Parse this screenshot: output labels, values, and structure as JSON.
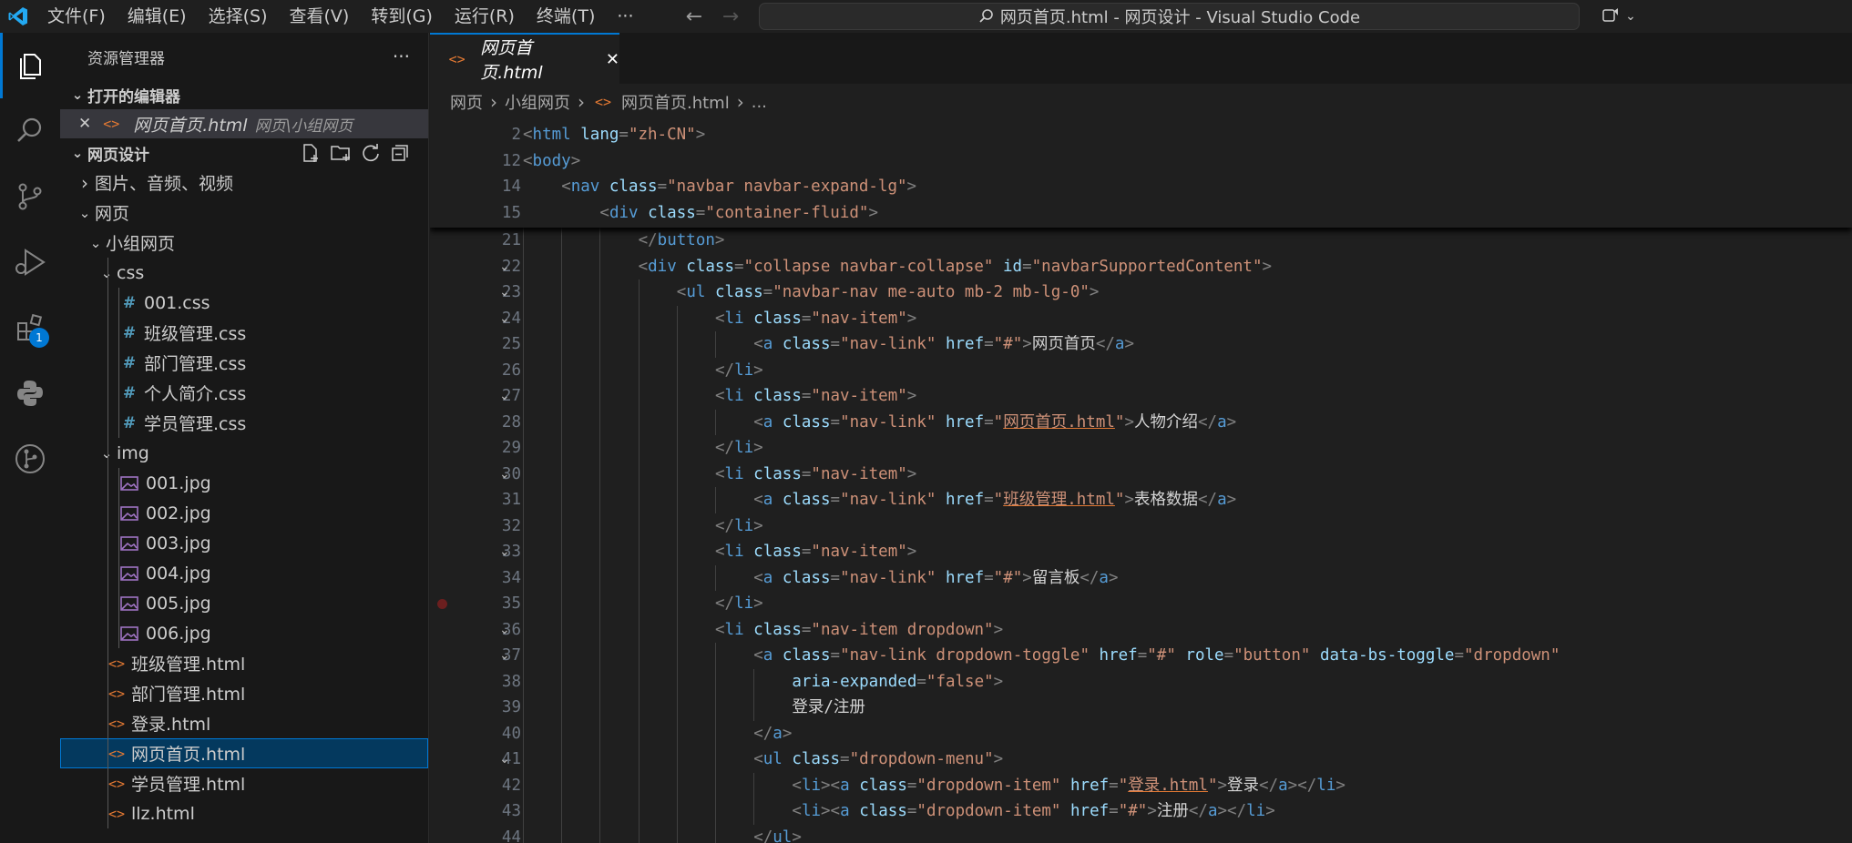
{
  "titlebar": {
    "menus": [
      "文件(F)",
      "编辑(E)",
      "选择(S)",
      "查看(V)",
      "转到(G)",
      "运行(R)",
      "终端(T)",
      "···"
    ],
    "command_center": "网页首页.html - 网页设计 - Visual Studio Code",
    "back_arrow": "←",
    "forward_arrow": "→"
  },
  "activitybar": {
    "extensions_badge": "1"
  },
  "sidebar": {
    "title": "资源管理器",
    "more": "···",
    "open_editors_header": "打开的编辑器",
    "open_editor": {
      "name": "网页首页.html",
      "path": "网页\\小组网页"
    },
    "workspace_header": "网页设计",
    "tree": [
      {
        "label": "图片、音频、视频",
        "kind": "folder",
        "depth": 0,
        "open": false
      },
      {
        "label": "网页",
        "kind": "folder",
        "depth": 0,
        "open": true
      },
      {
        "label": "小组网页",
        "kind": "folder",
        "depth": 1,
        "open": true
      },
      {
        "label": "css",
        "kind": "folder",
        "depth": 2,
        "open": true
      },
      {
        "label": "001.css",
        "kind": "css",
        "depth": 3
      },
      {
        "label": "班级管理.css",
        "kind": "css",
        "depth": 3
      },
      {
        "label": "部门管理.css",
        "kind": "css",
        "depth": 3
      },
      {
        "label": "个人简介.css",
        "kind": "css",
        "depth": 3
      },
      {
        "label": "学员管理.css",
        "kind": "css",
        "depth": 3
      },
      {
        "label": "img",
        "kind": "folder",
        "depth": 2,
        "open": true
      },
      {
        "label": "001.jpg",
        "kind": "img",
        "depth": 3
      },
      {
        "label": "002.jpg",
        "kind": "img",
        "depth": 3
      },
      {
        "label": "003.jpg",
        "kind": "img",
        "depth": 3
      },
      {
        "label": "004.jpg",
        "kind": "img",
        "depth": 3
      },
      {
        "label": "005.jpg",
        "kind": "img",
        "depth": 3
      },
      {
        "label": "006.jpg",
        "kind": "img",
        "depth": 3
      },
      {
        "label": "班级管理.html",
        "kind": "html",
        "depth": 2
      },
      {
        "label": "部门管理.html",
        "kind": "html",
        "depth": 2
      },
      {
        "label": "登录.html",
        "kind": "html",
        "depth": 2
      },
      {
        "label": "网页首页.html",
        "kind": "html",
        "depth": 2,
        "selected": true
      },
      {
        "label": "学员管理.html",
        "kind": "html",
        "depth": 2
      },
      {
        "label": "llz.html",
        "kind": "html",
        "depth": 2
      }
    ]
  },
  "editor": {
    "tab_label": "网页首页.html",
    "breadcrumb": [
      "网页",
      "小组网页",
      "网页首页.html",
      "..."
    ],
    "sticky_lines": [
      {
        "n": "2",
        "indent": 0,
        "tokens": [
          [
            "pn",
            "<"
          ],
          [
            "tg",
            "html"
          ],
          [
            "tx",
            " "
          ],
          [
            "at",
            "lang"
          ],
          [
            "pn",
            "="
          ],
          [
            "st",
            "\"zh-CN\""
          ],
          [
            "pn",
            ">"
          ]
        ]
      },
      {
        "n": "12",
        "indent": 0,
        "tokens": [
          [
            "pn",
            "<"
          ],
          [
            "tg",
            "body"
          ],
          [
            "pn",
            ">"
          ]
        ]
      },
      {
        "n": "14",
        "indent": 1,
        "tokens": [
          [
            "pn",
            "<"
          ],
          [
            "tg",
            "nav"
          ],
          [
            "tx",
            " "
          ],
          [
            "at",
            "class"
          ],
          [
            "pn",
            "="
          ],
          [
            "st",
            "\"navbar navbar-expand-lg\""
          ],
          [
            "pn",
            ">"
          ]
        ]
      },
      {
        "n": "15",
        "indent": 2,
        "tokens": [
          [
            "pn",
            "<"
          ],
          [
            "tg",
            "div"
          ],
          [
            "tx",
            " "
          ],
          [
            "at",
            "class"
          ],
          [
            "pn",
            "="
          ],
          [
            "st",
            "\"container-fluid\""
          ],
          [
            "pn",
            ">"
          ]
        ]
      }
    ],
    "lines": [
      {
        "n": "21",
        "indent": 3,
        "tokens": [
          [
            "pn",
            "</"
          ],
          [
            "tg",
            "button"
          ],
          [
            "pn",
            ">"
          ]
        ]
      },
      {
        "n": "22",
        "indent": 3,
        "fold": true,
        "tokens": [
          [
            "pn",
            "<"
          ],
          [
            "tg",
            "div"
          ],
          [
            "tx",
            " "
          ],
          [
            "at",
            "class"
          ],
          [
            "pn",
            "="
          ],
          [
            "st",
            "\"collapse navbar-collapse\""
          ],
          [
            "tx",
            " "
          ],
          [
            "at",
            "id"
          ],
          [
            "pn",
            "="
          ],
          [
            "st",
            "\"navbarSupportedContent\""
          ],
          [
            "pn",
            ">"
          ]
        ]
      },
      {
        "n": "23",
        "indent": 4,
        "fold": true,
        "tokens": [
          [
            "pn",
            "<"
          ],
          [
            "tg",
            "ul"
          ],
          [
            "tx",
            " "
          ],
          [
            "at",
            "class"
          ],
          [
            "pn",
            "="
          ],
          [
            "st",
            "\"navbar-nav me-auto mb-2 mb-lg-0\""
          ],
          [
            "pn",
            ">"
          ]
        ]
      },
      {
        "n": "24",
        "indent": 5,
        "fold": true,
        "tokens": [
          [
            "pn",
            "<"
          ],
          [
            "tg",
            "li"
          ],
          [
            "tx",
            " "
          ],
          [
            "at",
            "class"
          ],
          [
            "pn",
            "="
          ],
          [
            "st",
            "\"nav-item\""
          ],
          [
            "pn",
            ">"
          ]
        ]
      },
      {
        "n": "25",
        "indent": 6,
        "tokens": [
          [
            "pn",
            "<"
          ],
          [
            "tg",
            "a"
          ],
          [
            "tx",
            " "
          ],
          [
            "at",
            "class"
          ],
          [
            "pn",
            "="
          ],
          [
            "st",
            "\"nav-link\""
          ],
          [
            "tx",
            " "
          ],
          [
            "at",
            "href"
          ],
          [
            "pn",
            "="
          ],
          [
            "st",
            "\"#\""
          ],
          [
            "pn",
            ">"
          ],
          [
            "tx",
            "网页首页"
          ],
          [
            "pn",
            "</"
          ],
          [
            "tg",
            "a"
          ],
          [
            "pn",
            ">"
          ]
        ]
      },
      {
        "n": "26",
        "indent": 5,
        "tokens": [
          [
            "pn",
            "</"
          ],
          [
            "tg",
            "li"
          ],
          [
            "pn",
            ">"
          ]
        ]
      },
      {
        "n": "27",
        "indent": 5,
        "fold": true,
        "tokens": [
          [
            "pn",
            "<"
          ],
          [
            "tg",
            "li"
          ],
          [
            "tx",
            " "
          ],
          [
            "at",
            "class"
          ],
          [
            "pn",
            "="
          ],
          [
            "st",
            "\"nav-item\""
          ],
          [
            "pn",
            ">"
          ]
        ]
      },
      {
        "n": "28",
        "indent": 6,
        "tokens": [
          [
            "pn",
            "<"
          ],
          [
            "tg",
            "a"
          ],
          [
            "tx",
            " "
          ],
          [
            "at",
            "class"
          ],
          [
            "pn",
            "="
          ],
          [
            "st",
            "\"nav-link\""
          ],
          [
            "tx",
            " "
          ],
          [
            "at",
            "href"
          ],
          [
            "pn",
            "="
          ],
          [
            "st",
            "\""
          ],
          [
            "stu",
            "网页首页.html"
          ],
          [
            "st",
            "\""
          ],
          [
            "pn",
            ">"
          ],
          [
            "tx",
            "人物介绍"
          ],
          [
            "pn",
            "</"
          ],
          [
            "tg",
            "a"
          ],
          [
            "pn",
            ">"
          ]
        ]
      },
      {
        "n": "29",
        "indent": 5,
        "tokens": [
          [
            "pn",
            "</"
          ],
          [
            "tg",
            "li"
          ],
          [
            "pn",
            ">"
          ]
        ]
      },
      {
        "n": "30",
        "indent": 5,
        "fold": true,
        "tokens": [
          [
            "pn",
            "<"
          ],
          [
            "tg",
            "li"
          ],
          [
            "tx",
            " "
          ],
          [
            "at",
            "class"
          ],
          [
            "pn",
            "="
          ],
          [
            "st",
            "\"nav-item\""
          ],
          [
            "pn",
            ">"
          ]
        ]
      },
      {
        "n": "31",
        "indent": 6,
        "tokens": [
          [
            "pn",
            "<"
          ],
          [
            "tg",
            "a"
          ],
          [
            "tx",
            " "
          ],
          [
            "at",
            "class"
          ],
          [
            "pn",
            "="
          ],
          [
            "st",
            "\"nav-link\""
          ],
          [
            "tx",
            " "
          ],
          [
            "at",
            "href"
          ],
          [
            "pn",
            "="
          ],
          [
            "st",
            "\""
          ],
          [
            "stu",
            "班级管理.html"
          ],
          [
            "st",
            "\""
          ],
          [
            "pn",
            ">"
          ],
          [
            "tx",
            "表格数据"
          ],
          [
            "pn",
            "</"
          ],
          [
            "tg",
            "a"
          ],
          [
            "pn",
            ">"
          ]
        ]
      },
      {
        "n": "32",
        "indent": 5,
        "tokens": [
          [
            "pn",
            "</"
          ],
          [
            "tg",
            "li"
          ],
          [
            "pn",
            ">"
          ]
        ]
      },
      {
        "n": "33",
        "indent": 5,
        "fold": true,
        "tokens": [
          [
            "pn",
            "<"
          ],
          [
            "tg",
            "li"
          ],
          [
            "tx",
            " "
          ],
          [
            "at",
            "class"
          ],
          [
            "pn",
            "="
          ],
          [
            "st",
            "\"nav-item\""
          ],
          [
            "pn",
            ">"
          ]
        ]
      },
      {
        "n": "34",
        "indent": 6,
        "tokens": [
          [
            "pn",
            "<"
          ],
          [
            "tg",
            "a"
          ],
          [
            "tx",
            " "
          ],
          [
            "at",
            "class"
          ],
          [
            "pn",
            "="
          ],
          [
            "st",
            "\"nav-link\""
          ],
          [
            "tx",
            " "
          ],
          [
            "at",
            "href"
          ],
          [
            "pn",
            "="
          ],
          [
            "st",
            "\"#\""
          ],
          [
            "pn",
            ">"
          ],
          [
            "tx",
            "留言板"
          ],
          [
            "pn",
            "</"
          ],
          [
            "tg",
            "a"
          ],
          [
            "pn",
            ">"
          ]
        ]
      },
      {
        "n": "35",
        "indent": 5,
        "breakpoint": true,
        "tokens": [
          [
            "pn",
            "</"
          ],
          [
            "tg",
            "li"
          ],
          [
            "pn",
            ">"
          ]
        ]
      },
      {
        "n": "36",
        "indent": 5,
        "fold": true,
        "tokens": [
          [
            "pn",
            "<"
          ],
          [
            "tg",
            "li"
          ],
          [
            "tx",
            " "
          ],
          [
            "at",
            "class"
          ],
          [
            "pn",
            "="
          ],
          [
            "st",
            "\"nav-item dropdown\""
          ],
          [
            "pn",
            ">"
          ]
        ]
      },
      {
        "n": "37",
        "indent": 6,
        "fold": true,
        "tokens": [
          [
            "pn",
            "<"
          ],
          [
            "tg",
            "a"
          ],
          [
            "tx",
            " "
          ],
          [
            "at",
            "class"
          ],
          [
            "pn",
            "="
          ],
          [
            "st",
            "\"nav-link dropdown-toggle\""
          ],
          [
            "tx",
            " "
          ],
          [
            "at",
            "href"
          ],
          [
            "pn",
            "="
          ],
          [
            "st",
            "\"#\""
          ],
          [
            "tx",
            " "
          ],
          [
            "at",
            "role"
          ],
          [
            "pn",
            "="
          ],
          [
            "st",
            "\"button\""
          ],
          [
            "tx",
            " "
          ],
          [
            "at",
            "data-bs-toggle"
          ],
          [
            "pn",
            "="
          ],
          [
            "st",
            "\"dropdown\""
          ]
        ]
      },
      {
        "n": "38",
        "indent": 7,
        "tokens": [
          [
            "at",
            "aria-expanded"
          ],
          [
            "pn",
            "="
          ],
          [
            "st",
            "\"false\""
          ],
          [
            "pn",
            ">"
          ]
        ]
      },
      {
        "n": "39",
        "indent": 7,
        "tokens": [
          [
            "tx",
            "登录/注册"
          ]
        ]
      },
      {
        "n": "40",
        "indent": 6,
        "tokens": [
          [
            "pn",
            "</"
          ],
          [
            "tg",
            "a"
          ],
          [
            "pn",
            ">"
          ]
        ]
      },
      {
        "n": "41",
        "indent": 6,
        "fold": true,
        "tokens": [
          [
            "pn",
            "<"
          ],
          [
            "tg",
            "ul"
          ],
          [
            "tx",
            " "
          ],
          [
            "at",
            "class"
          ],
          [
            "pn",
            "="
          ],
          [
            "st",
            "\"dropdown-menu\""
          ],
          [
            "pn",
            ">"
          ]
        ]
      },
      {
        "n": "42",
        "indent": 7,
        "tokens": [
          [
            "pn",
            "<"
          ],
          [
            "tg",
            "li"
          ],
          [
            "pn",
            "><"
          ],
          [
            "tg",
            "a"
          ],
          [
            "tx",
            " "
          ],
          [
            "at",
            "class"
          ],
          [
            "pn",
            "="
          ],
          [
            "st",
            "\"dropdown-item\""
          ],
          [
            "tx",
            " "
          ],
          [
            "at",
            "href"
          ],
          [
            "pn",
            "="
          ],
          [
            "st",
            "\""
          ],
          [
            "stu",
            "登录.html"
          ],
          [
            "st",
            "\""
          ],
          [
            "pn",
            ">"
          ],
          [
            "tx",
            "登录"
          ],
          [
            "pn",
            "</"
          ],
          [
            "tg",
            "a"
          ],
          [
            "pn",
            "></"
          ],
          [
            "tg",
            "li"
          ],
          [
            "pn",
            ">"
          ]
        ]
      },
      {
        "n": "43",
        "indent": 7,
        "tokens": [
          [
            "pn",
            "<"
          ],
          [
            "tg",
            "li"
          ],
          [
            "pn",
            "><"
          ],
          [
            "tg",
            "a"
          ],
          [
            "tx",
            " "
          ],
          [
            "at",
            "class"
          ],
          [
            "pn",
            "="
          ],
          [
            "st",
            "\"dropdown-item\""
          ],
          [
            "tx",
            " "
          ],
          [
            "at",
            "href"
          ],
          [
            "pn",
            "="
          ],
          [
            "st",
            "\"#\""
          ],
          [
            "pn",
            ">"
          ],
          [
            "tx",
            "注册"
          ],
          [
            "pn",
            "</"
          ],
          [
            "tg",
            "a"
          ],
          [
            "pn",
            "></"
          ],
          [
            "tg",
            "li"
          ],
          [
            "pn",
            ">"
          ]
        ]
      },
      {
        "n": "44",
        "indent": 6,
        "tokens": [
          [
            "pn",
            "</"
          ],
          [
            "tg",
            "ul"
          ],
          [
            "pn",
            ">"
          ]
        ]
      }
    ]
  },
  "colors": {
    "accent": "#0078d4",
    "html_icon": "#e37933",
    "css_icon": "#519aba",
    "img_icon": "#a074c4"
  }
}
